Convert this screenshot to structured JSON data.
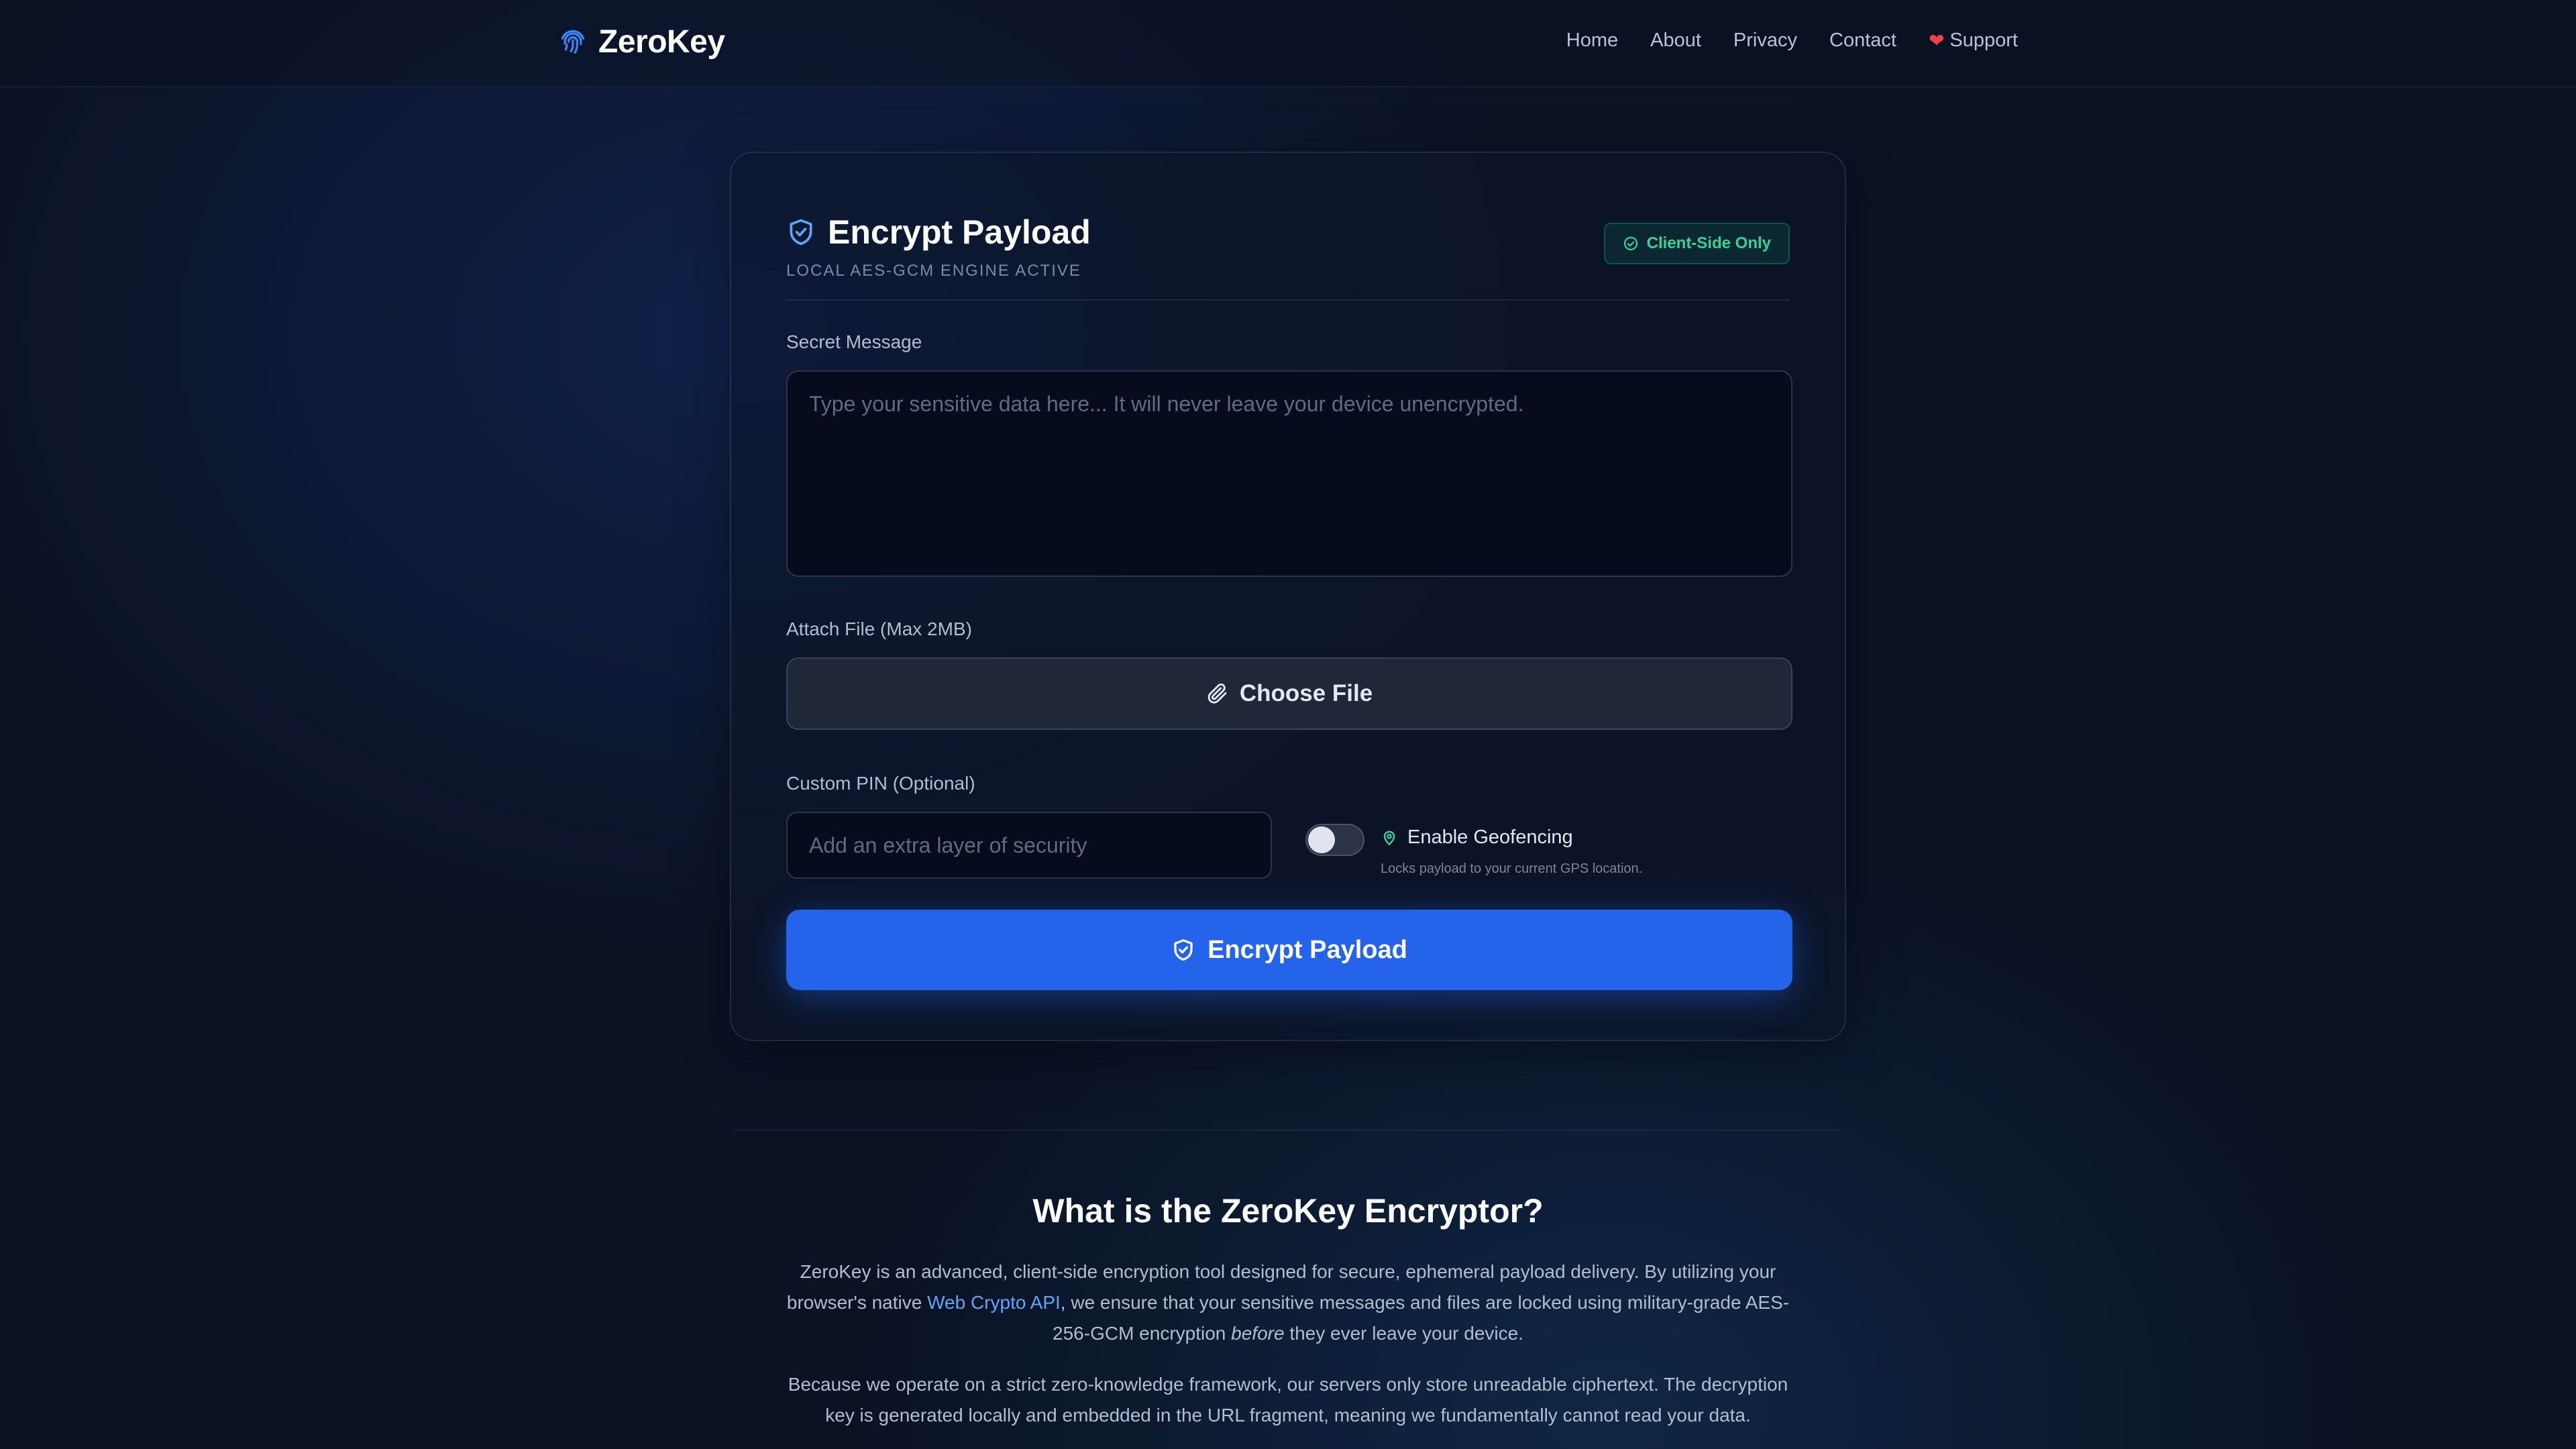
{
  "nav": {
    "brand": "ZeroKey",
    "links": [
      "Home",
      "About",
      "Privacy",
      "Contact"
    ],
    "support": "Support"
  },
  "card": {
    "title": "Encrypt Payload",
    "subtitle": "LOCAL AES-GCM ENGINE ACTIVE",
    "badge": "Client-Side Only",
    "message_label": "Secret Message",
    "message_placeholder": "Type your sensitive data here... It will never leave your device unencrypted.",
    "file_label": "Attach File (Max 2MB)",
    "file_button": "Choose File",
    "pin_label": "Custom PIN (Optional)",
    "pin_placeholder": "Add an extra layer of security",
    "geofencing_label": "Enable Geofencing",
    "geofencing_hint": "Locks payload to your current GPS location.",
    "geofencing_enabled": false,
    "submit": "Encrypt Payload"
  },
  "info": {
    "title": "What is the ZeroKey Encryptor?",
    "p1_a": "ZeroKey is an advanced, client-side encryption tool designed for secure, ephemeral payload delivery. By utilizing your browser's native ",
    "p1_link": "Web Crypto API",
    "p1_b": ", we ensure that your sensitive messages and files are locked using military-grade AES-256-GCM encryption ",
    "p1_em": "before",
    "p1_c": " they ever leave your device.",
    "p2": "Because we operate on a strict zero-knowledge framework, our servers only store unreadable ciphertext. The decryption key is generated locally and embedded in the URL fragment, meaning we fundamentally cannot read your data."
  },
  "colors": {
    "accent": "#2563eb",
    "success": "#34d399",
    "link": "#60a5fa",
    "background": "#0a1224"
  },
  "icons": {
    "brand": "fingerprint-icon",
    "title": "shield-check-icon",
    "badge": "check-circle-icon",
    "file": "paperclip-icon",
    "geo": "map-pin-icon",
    "support": "heart-icon"
  }
}
